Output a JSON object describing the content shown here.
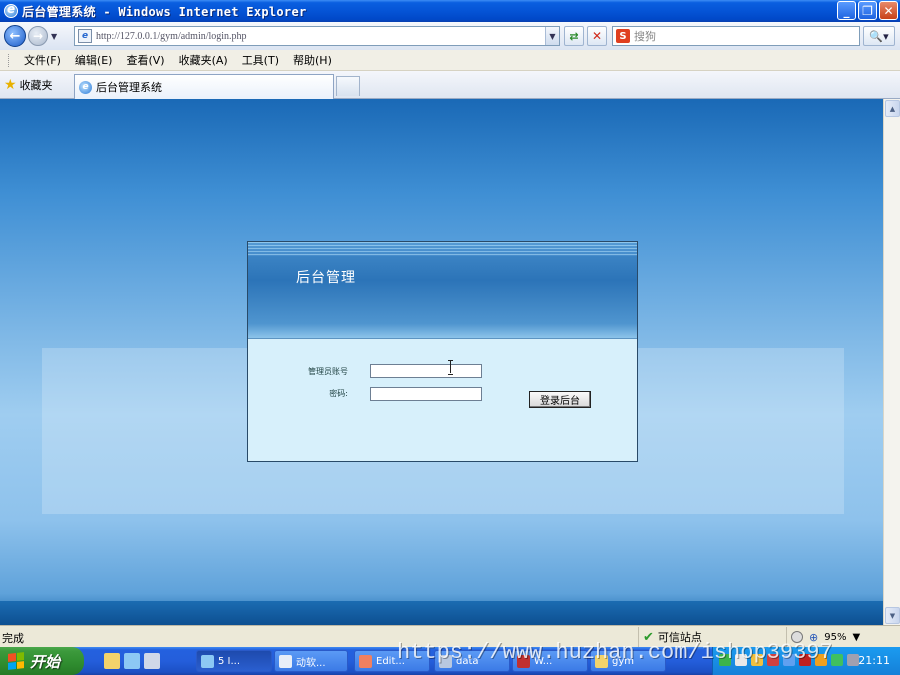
{
  "window": {
    "title": "后台管理系统 - Windows Internet Explorer"
  },
  "navbar": {
    "url": "http://127.0.0.1/gym/admin/login.php",
    "search_placeholder": "搜狗"
  },
  "menu": {
    "items": [
      "文件(F)",
      "编辑(E)",
      "查看(V)",
      "收藏夹(A)",
      "工具(T)",
      "帮助(H)"
    ]
  },
  "favorites": {
    "label": "收藏夹",
    "tab_title": "后台管理系统"
  },
  "login": {
    "title": "后台管理",
    "username_label": "管理员账号",
    "password_label": "密码:",
    "submit_label": "登录后台"
  },
  "status": {
    "text": "完成",
    "zone": "可信站点",
    "zoom": "95%"
  },
  "watermark": {
    "text": "https://www.huzhan.com/ishop39397"
  },
  "taskbar": {
    "start_label": "开始",
    "tasks": [
      "5 I...",
      "动软...",
      "Edit...",
      "data",
      "W...",
      "gym"
    ],
    "clock": "21:11"
  }
}
